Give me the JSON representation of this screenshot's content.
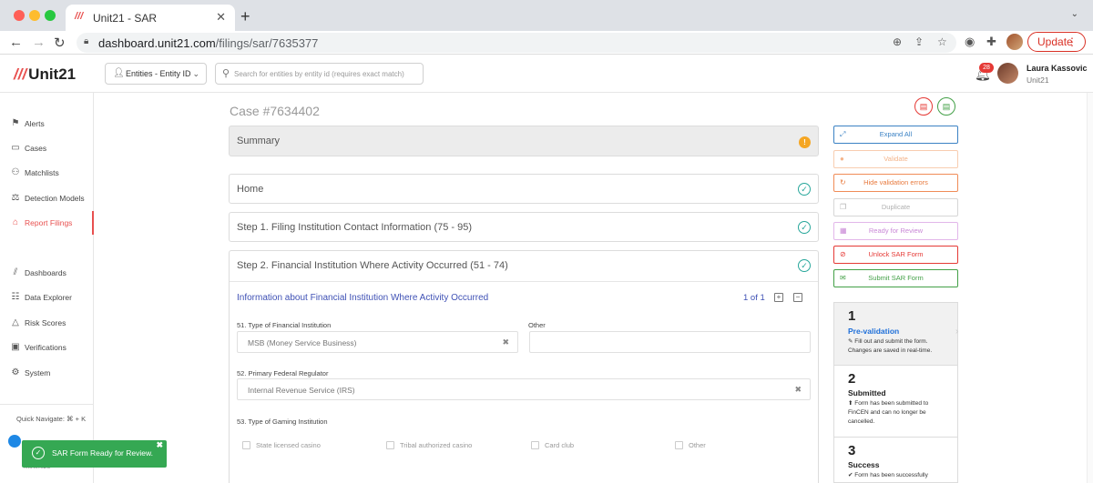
{
  "browser": {
    "tab_title": "Unit21 - SAR",
    "tab_logo": "///",
    "url_host": "dashboard.unit21.com",
    "url_path": "/filings/sar/7635377",
    "update_label": "Update"
  },
  "header": {
    "logo_text": "Unit21",
    "entity_select_label": "Entities - Entity ID",
    "search_placeholder": "Search for entities by entity id (requires exact match)",
    "notification_count": "28",
    "user_name": "Laura Kassovic",
    "user_org": "Unit21"
  },
  "sidebar": {
    "items": [
      {
        "label": "Alerts",
        "icon": "flag-icon"
      },
      {
        "label": "Cases",
        "icon": "briefcase-icon"
      },
      {
        "label": "Matchlists",
        "icon": "user-plus-icon"
      },
      {
        "label": "Detection Models",
        "icon": "scale-icon"
      },
      {
        "label": "Report Filings",
        "icon": "bank-icon"
      },
      {
        "label": "Dashboards",
        "icon": "chart-icon"
      },
      {
        "label": "Data Explorer",
        "icon": "data-search-icon"
      },
      {
        "label": "Risk Scores",
        "icon": "warning-icon"
      },
      {
        "label": "Verifications",
        "icon": "id-card-icon"
      },
      {
        "label": "System",
        "icon": "gear-icon"
      }
    ],
    "quick_navigate": "Quick Navigate:  ⌘ + K",
    "minimize": "Minimize"
  },
  "main": {
    "case_title": "Case #7634402",
    "sections": {
      "summary": "Summary",
      "home": "Home",
      "step1": "Step 1. Filing Institution Contact Information (75 - 95)",
      "step2": "Step 2. Financial Institution Where Activity Occurred (51 - 74)"
    },
    "step2": {
      "info_title": "Information about Financial Institution Where Activity Occurred",
      "pager": "1 of 1",
      "field51_label": "51. Type of Financial Institution",
      "field51_value": "MSB (Money Service Business)",
      "other_label": "Other",
      "field52_label": "52. Primary Federal Regulator",
      "field52_value": "Internal Revenue Service (IRS)",
      "field53_label": "53. Type of Gaming Institution",
      "gaming_options": [
        "State licensed casino",
        "Tribal authorized casino",
        "Card club",
        "Other"
      ]
    }
  },
  "actions": {
    "expand_all": "Expand All",
    "validate": "Validate",
    "hide_errors": "Hide validation errors",
    "duplicate": "Duplicate",
    "ready": "Ready for Review",
    "unlock": "Unlock SAR Form",
    "submit": "Submit SAR Form"
  },
  "stepper": {
    "stages": [
      {
        "num": "1",
        "name": "Pre-validation",
        "desc": "Fill out and submit the form. Changes are saved in real-time."
      },
      {
        "num": "2",
        "name": "Submitted",
        "desc": "Form has been submitted to FinCEN and can no longer be cancelled."
      },
      {
        "num": "3",
        "name": "Success",
        "desc": "Form has been successfully"
      }
    ]
  },
  "toast": {
    "message": "SAR Form Ready for Review."
  },
  "colors": {
    "brand_red": "#e8504f",
    "link_blue": "#3f51b5",
    "success_green": "#35a853"
  }
}
